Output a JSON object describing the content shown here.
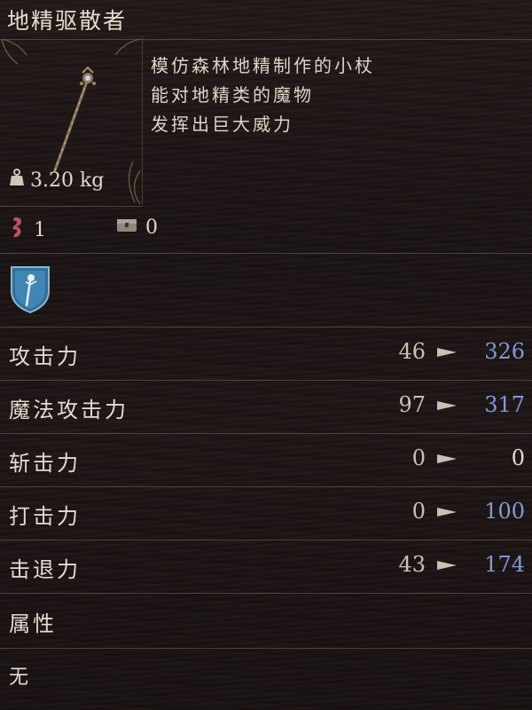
{
  "item": {
    "name": "地精驱散者",
    "description": [
      "模仿森林地精制作的小杖",
      "能对地精类的魔物",
      "发挥出巨大威力"
    ],
    "weight": "3.20 kg",
    "counter_a": "1",
    "counter_b": "0"
  },
  "stats": [
    {
      "label": "攻击力",
      "base": "46",
      "new": "326",
      "new_color": "#7f9ad6"
    },
    {
      "label": "魔法攻击力",
      "base": "97",
      "new": "317",
      "new_color": "#7f9ad6"
    },
    {
      "label": "斩击力",
      "base": "0",
      "new": "0",
      "new_color": "#e2dcd0"
    },
    {
      "label": "打击力",
      "base": "0",
      "new": "100",
      "new_color": "#7f9ad6"
    },
    {
      "label": "击退力",
      "base": "43",
      "new": "174",
      "new_color": "#7f9ad6"
    }
  ],
  "attribute": {
    "label": "属性",
    "value": "无"
  },
  "icons": {
    "weight": "weight-icon",
    "counter_a": "red-rune-icon",
    "counter_b": "chest-icon",
    "type": "staff-shield-icon",
    "arrow": "arrow-right-icon"
  }
}
